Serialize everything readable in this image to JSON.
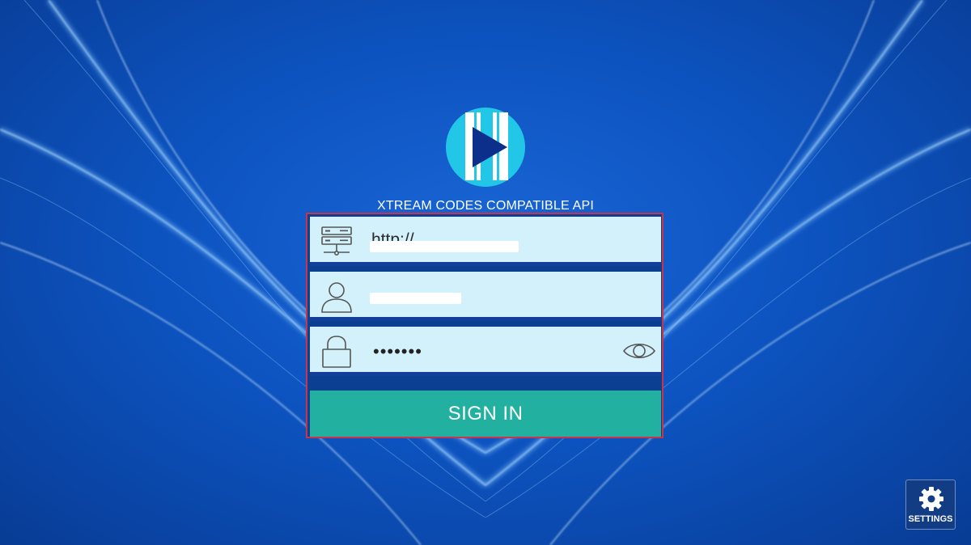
{
  "app": {
    "title": "XTREAM CODES COMPATIBLE API"
  },
  "form": {
    "server_url": {
      "value": "http://",
      "icon": "server-icon"
    },
    "username": {
      "value": "",
      "icon": "user-icon"
    },
    "password": {
      "value": "•••••••",
      "icon": "lock-icon",
      "toggle_icon": "eye-icon"
    },
    "sign_in_label": "SIGN IN"
  },
  "settings": {
    "label": "SETTINGS",
    "icon": "gear-icon"
  },
  "colors": {
    "background": "#0d54c1",
    "field": "#d3f1fb",
    "field_divider": "#123f9c",
    "sign_in": "#22b1a0",
    "highlight_border": "#c8344a",
    "logo_circle": "#22c7e8"
  }
}
